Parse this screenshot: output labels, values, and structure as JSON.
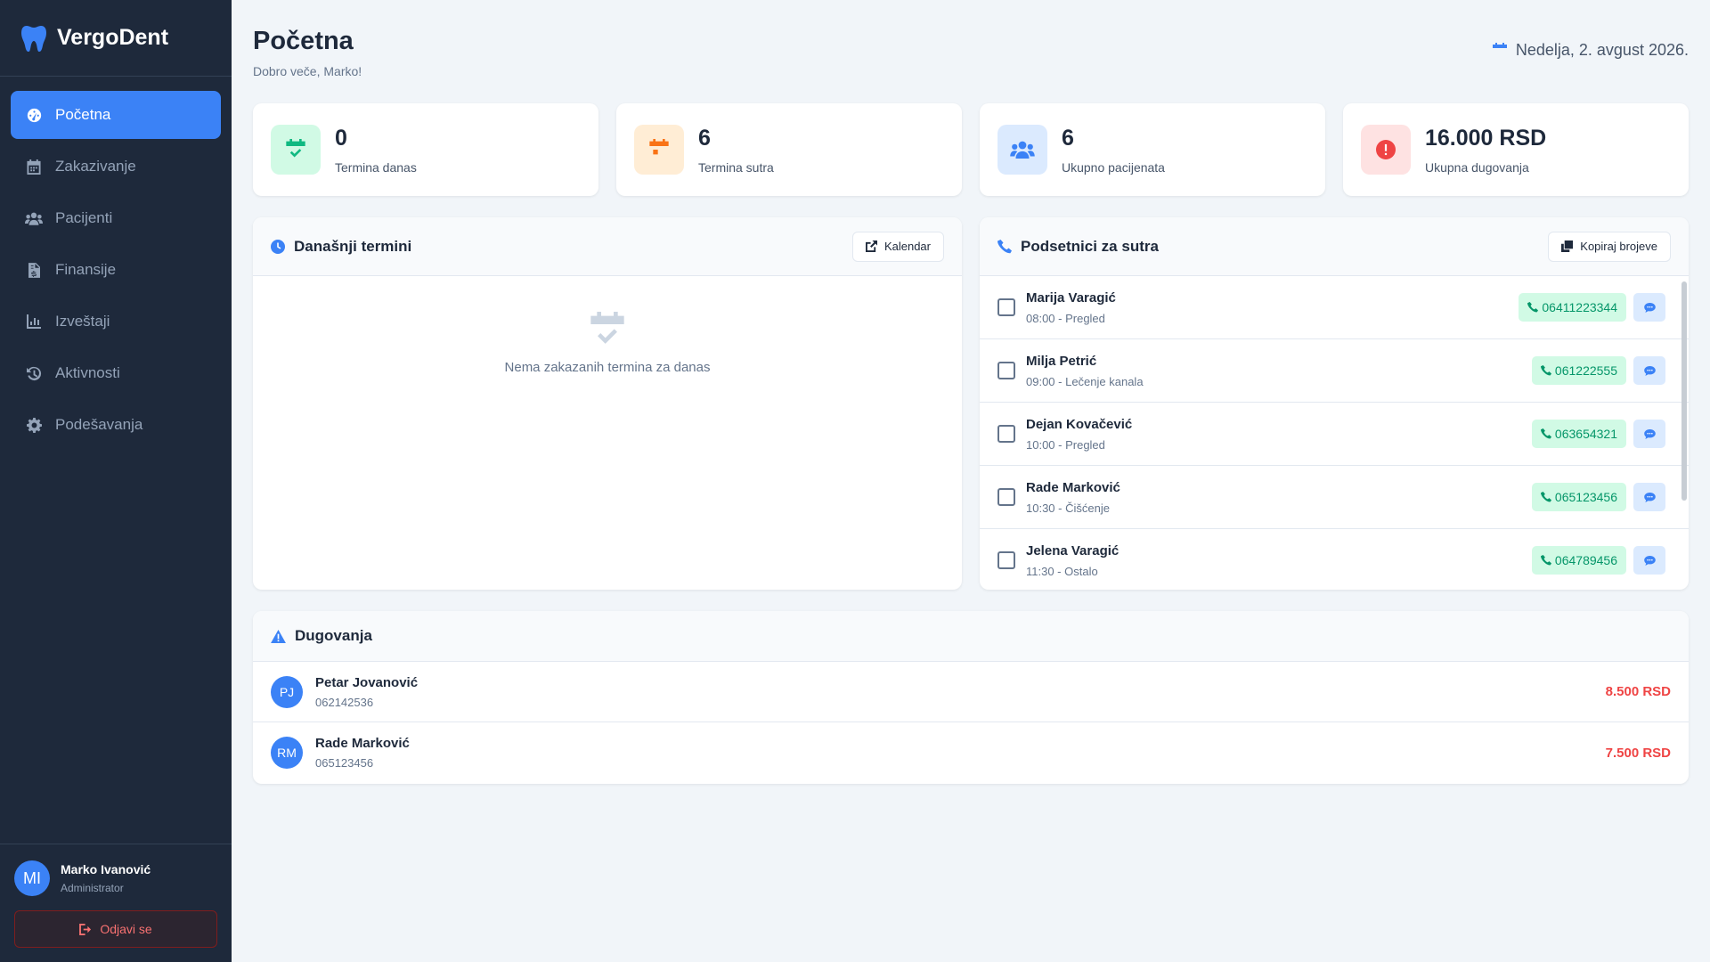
{
  "app": {
    "name": "VergoDent"
  },
  "sidebar": {
    "items": [
      {
        "label": "Početna",
        "icon": "dashboard-icon"
      },
      {
        "label": "Zakazivanje",
        "icon": "calendar-icon"
      },
      {
        "label": "Pacijenti",
        "icon": "users-icon"
      },
      {
        "label": "Finansije",
        "icon": "invoice-icon"
      },
      {
        "label": "Izveštaji",
        "icon": "chart-icon"
      },
      {
        "label": "Aktivnosti",
        "icon": "history-icon"
      },
      {
        "label": "Podešavanja",
        "icon": "gear-icon"
      }
    ],
    "active_index": 0
  },
  "user": {
    "initials": "MI",
    "name": "Marko Ivanović",
    "role": "Administrator",
    "logout_label": "Odjavi se"
  },
  "header": {
    "title": "Početna",
    "greeting": "Dobro veče, Marko!",
    "date": "Nedelja, 2. avgust 2026."
  },
  "stats": [
    {
      "value": "0",
      "label": "Termina danas",
      "color": "#10b981",
      "bg": "#d1fae5"
    },
    {
      "value": "6",
      "label": "Termina sutra",
      "color": "#f97316",
      "bg": "#ffedd5"
    },
    {
      "value": "6",
      "label": "Ukupno pacijenata",
      "color": "#3b82f6",
      "bg": "#dbeafe"
    },
    {
      "value": "16.000 RSD",
      "label": "Ukupna dugovanja",
      "color": "#ef4444",
      "bg": "#fee2e2"
    }
  ],
  "today": {
    "title": "Današnji termini",
    "button": "Kalendar",
    "empty_text": "Nema zakazanih termina za danas"
  },
  "reminders": {
    "title": "Podsetnici za sutra",
    "button": "Kopiraj brojeve",
    "rows": [
      {
        "name": "Marija Varagić",
        "info": "08:00 - Pregled",
        "phone": "06411223344"
      },
      {
        "name": "Milja Petrić",
        "info": "09:00 - Lečenje kanala",
        "phone": "061222555"
      },
      {
        "name": "Dejan Kovačević",
        "info": "10:00 - Pregled",
        "phone": "063654321"
      },
      {
        "name": "Rade Marković",
        "info": "10:30 - Čišćenje",
        "phone": "065123456"
      },
      {
        "name": "Jelena Varagić",
        "info": "11:30 - Ostalo",
        "phone": "064789456"
      }
    ]
  },
  "debts": {
    "title": "Dugovanja",
    "rows": [
      {
        "initials": "PJ",
        "name": "Petar Jovanović",
        "phone": "062142536",
        "amount": "8.500 RSD"
      },
      {
        "initials": "RM",
        "name": "Rade Marković",
        "phone": "065123456",
        "amount": "7.500 RSD"
      }
    ]
  }
}
